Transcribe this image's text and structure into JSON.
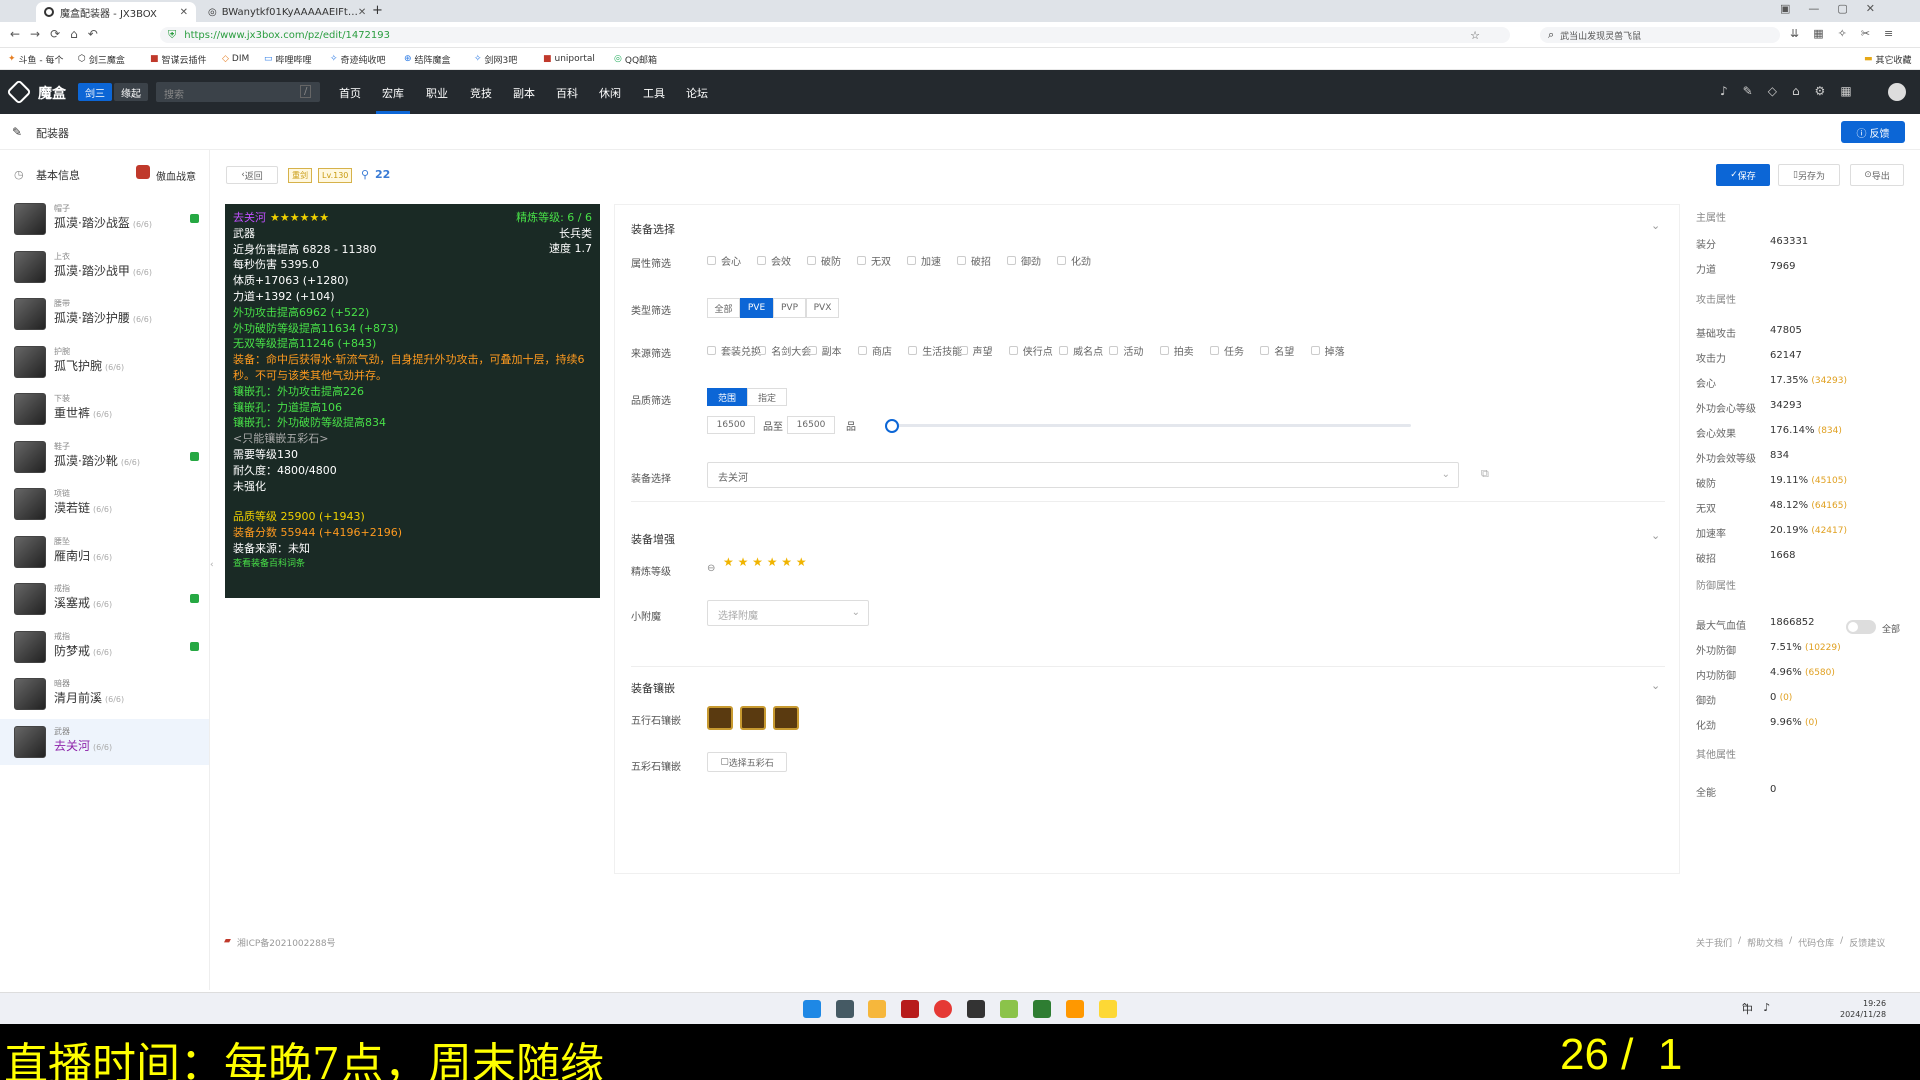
{
  "browser": {
    "tabs": [
      "魔盒配装器 - JX3BOX",
      "BWanytkf01KyAAAAAEIFt…"
    ],
    "url": "https://www.jx3box.com/pz/edit/1472193",
    "search_text": "武当山发现灵兽飞鼠",
    "bookmarks": [
      "斗鱼 - 每个",
      "剑三魔盒",
      "智谋云插件",
      "DIM",
      "哔哩哔哩",
      "奇迹纯收吧",
      "结阵魔盒",
      "剑网3吧",
      "uniportal",
      "QQ邮箱"
    ],
    "other_bookmarks": "其它收藏"
  },
  "nav": {
    "brand": "魔盒",
    "switch": [
      "剑三",
      "缘起"
    ],
    "search_placeholder": "搜索",
    "search_key": "/",
    "links": [
      "首页",
      "宏库",
      "职业",
      "竞技",
      "副本",
      "百科",
      "休闲",
      "工具",
      "论坛"
    ]
  },
  "subheader": {
    "title": "配装器",
    "feedback": "反馈"
  },
  "sidebar": {
    "section": "基本信息",
    "player": "傲血战意",
    "slots": [
      {
        "label": "帽子",
        "name": "孤漠·踏沙战盔",
        "count": "(6/6)",
        "mark": true
      },
      {
        "label": "上衣",
        "name": "孤漠·踏沙战甲",
        "count": "(6/6)",
        "mark": false
      },
      {
        "label": "腰带",
        "name": "孤漠·踏沙护腰",
        "count": "(6/6)",
        "mark": false
      },
      {
        "label": "护腕",
        "name": "孤飞护腕",
        "count": "(6/6)",
        "mark": false
      },
      {
        "label": "下装",
        "name": "重世裤",
        "count": "(6/6)",
        "mark": false
      },
      {
        "label": "鞋子",
        "name": "孤漠·踏沙靴",
        "count": "(6/6)",
        "mark": true
      },
      {
        "label": "项链",
        "name": "漠若链",
        "count": "(6/6)",
        "mark": false
      },
      {
        "label": "腰坠",
        "name": "雁南归",
        "count": "(6/6)",
        "mark": false
      },
      {
        "label": "戒指",
        "name": "溪塞戒",
        "count": "(6/6)",
        "mark": true
      },
      {
        "label": "戒指",
        "name": "防梦戒",
        "count": "(6/6)",
        "mark": true
      },
      {
        "label": "暗器",
        "name": "清月前溪",
        "count": "(6/6)",
        "mark": false
      },
      {
        "label": "武器",
        "name": "去关河",
        "count": "(6/6)",
        "mark": false
      }
    ]
  },
  "toolbar": {
    "back": "返回",
    "tag1": "重剑",
    "tag2": "Lv.130",
    "likes": "22",
    "save": "保存",
    "save_as": "另存为",
    "export": "导出"
  },
  "tooltip": {
    "name": "去关河",
    "stars": "★★★★★★",
    "refine": "精炼等级: 6 / 6",
    "type": "武器",
    "subtype": "长兵类",
    "lines": [
      {
        "t": "近身伤害提高 6828 - 11380",
        "c": "w"
      },
      {
        "t": "每秒伤害 5395.0",
        "c": "w"
      },
      {
        "t": "体质+17063 (+1280)",
        "c": "w"
      },
      {
        "t": "力道+1392 (+104)",
        "c": "w"
      },
      {
        "t": "外功攻击提高6962 (+522)",
        "c": "g"
      },
      {
        "t": "外功破防等级提高11634 (+873)",
        "c": "g"
      },
      {
        "t": "无双等级提高11246 (+843)",
        "c": "g"
      },
      {
        "t": "装备：命中后获得水·斩流气劲，自身提升外功攻击，可叠加十层，持续6",
        "c": "o"
      },
      {
        "t": "秒。不可与该类其他气劲并存。",
        "c": "o"
      },
      {
        "t": "镶嵌孔：外功攻击提高226",
        "c": "g"
      },
      {
        "t": "镶嵌孔：力道提高106",
        "c": "g"
      },
      {
        "t": "镶嵌孔：外功破防等级提高834",
        "c": "g"
      },
      {
        "t": "<只能镶嵌五彩石>",
        "c": "gr"
      },
      {
        "t": "需要等级130",
        "c": "w"
      },
      {
        "t": "耐久度：4800/4800",
        "c": "w"
      },
      {
        "t": "未强化",
        "c": "w"
      },
      {
        "t": "",
        "c": "w"
      },
      {
        "t": "品质等级 25900 (+1943)",
        "c": "y"
      },
      {
        "t": "装备分数 55944 (+4196+2196)",
        "c": "o"
      },
      {
        "t": "装备来源：未知",
        "c": "w"
      },
      {
        "t": "查看装备百科词条",
        "c": "g"
      }
    ],
    "speed": "速度 1.7"
  },
  "form": {
    "equip_select": "装备选择",
    "attr_filter": "属性筛选",
    "attrs": [
      "会心",
      "会效",
      "破防",
      "无双",
      "加速",
      "破招",
      "御劲",
      "化劲"
    ],
    "type_filter": "类型筛选",
    "types": [
      "全部",
      "PVE",
      "PVP",
      "PVX"
    ],
    "source_filter": "来源筛选",
    "sources": [
      "套装兑换",
      "名剑大会",
      "副本",
      "商店",
      "生活技能",
      "声望",
      "侠行点",
      "威名点",
      "活动",
      "拍卖",
      "任务",
      "名望",
      "掉落"
    ],
    "quality_filter": "品质筛选",
    "quality_tabs": [
      "范围",
      "指定"
    ],
    "q_min": "16500",
    "q_to": "品至",
    "q_max": "16500",
    "q_unit": "品",
    "equip_pick": "装备选择",
    "equip_value": "去关河",
    "enhance": "装备增强",
    "refine_label": "精炼等级",
    "refine_stars": "★ ★ ★ ★ ★ ★",
    "enchant_label": "小附魔",
    "enchant_placeholder": "选择附魔",
    "inlay": "装备镶嵌",
    "five_elem": "五行石镶嵌",
    "five_color": "五彩石镶嵌",
    "five_color_btn": "选择五彩石"
  },
  "stats": {
    "main": "主属性",
    "main_rows": [
      {
        "k": "装分",
        "v": "463331",
        "x": ""
      },
      {
        "k": "力道",
        "v": "7969",
        "x": ""
      }
    ],
    "attack": "攻击属性",
    "attack_rows": [
      {
        "k": "基础攻击",
        "v": "47805",
        "x": ""
      },
      {
        "k": "攻击力",
        "v": "62147",
        "x": ""
      },
      {
        "k": "会心",
        "v": "17.35%",
        "x": "(34293)"
      },
      {
        "k": "外功会心等级",
        "v": "34293",
        "x": ""
      },
      {
        "k": "会心效果",
        "v": "176.14%",
        "x": "(834)"
      },
      {
        "k": "外功会效等级",
        "v": "834",
        "x": ""
      },
      {
        "k": "破防",
        "v": "19.11%",
        "x": "(45105)"
      },
      {
        "k": "无双",
        "v": "48.12%",
        "x": "(64165)"
      },
      {
        "k": "加速率",
        "v": "20.19%",
        "x": "(42417)"
      },
      {
        "k": "破招",
        "v": "1668",
        "x": ""
      }
    ],
    "defense": "防御属性",
    "defense_toggle": "全部",
    "defense_rows": [
      {
        "k": "最大气血值",
        "v": "1866852",
        "x": ""
      },
      {
        "k": "外功防御",
        "v": "7.51%",
        "x": "(10229)"
      },
      {
        "k": "内功防御",
        "v": "4.96%",
        "x": "(6580)"
      },
      {
        "k": "御劲",
        "v": "0",
        "x": "(0)"
      },
      {
        "k": "化劲",
        "v": "9.96%",
        "x": "(0)"
      }
    ],
    "other": "其他属性",
    "other_rows": [
      {
        "k": "全能",
        "v": "0",
        "x": ""
      }
    ]
  },
  "footer": {
    "icp": "湘ICP备2021002288号",
    "links": [
      "关于我们",
      "帮助文档",
      "代码仓库",
      "反馈建议"
    ]
  },
  "taskbar": {
    "time": "19:26",
    "date": "2024/11/28",
    "ime": "中"
  },
  "overlay": {
    "text": "直播时间：每晚7点，周末随缘",
    "counter": "26 /  1"
  }
}
